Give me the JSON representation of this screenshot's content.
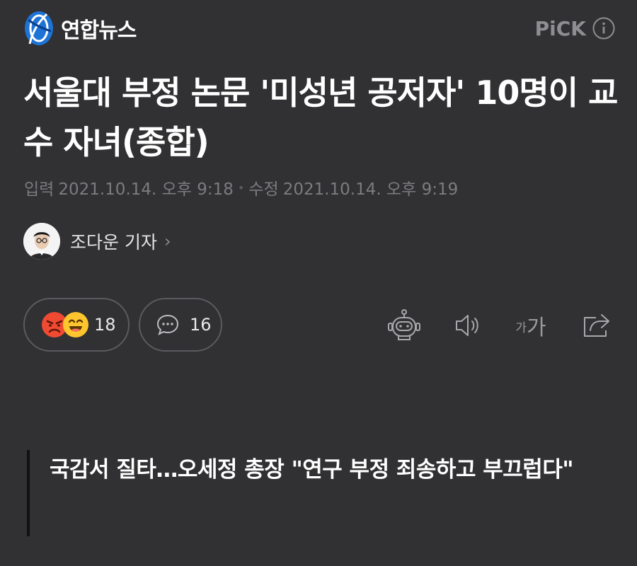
{
  "header": {
    "brand_name": "연합뉴스",
    "pick_label": "PiCK",
    "logo_icon": "yonhap-logo-icon",
    "info_icon": "info-icon"
  },
  "article": {
    "headline": "서울대 부정 논문 '미성년 공저자' 10명이 교수 자녀(종합)",
    "input_label": "입력",
    "input_datetime": "2021.10.14. 오후 9:18",
    "separator": "•",
    "modified_label": "수정",
    "modified_datetime": "2021.10.14. 오후 9:19",
    "reporter": "조다운 기자",
    "reporter_chevron": "›",
    "subheadline": "국감서 질타…오세정 총장 \"연구 부정 죄송하고 부끄럽다\""
  },
  "actions": {
    "reaction_count": "18",
    "comment_count": "16",
    "font_small": "가",
    "font_big": "가",
    "icons": [
      "angry-emoji-icon",
      "laugh-emoji-icon",
      "comment-bubble-icon",
      "robot-summary-icon",
      "speaker-icon",
      "font-size-icon",
      "share-icon"
    ]
  },
  "colors": {
    "background": "#313133",
    "brand_blue": "#1e73d6",
    "muted_text": "#7c7c80",
    "pill_border": "#5b5b5f"
  }
}
